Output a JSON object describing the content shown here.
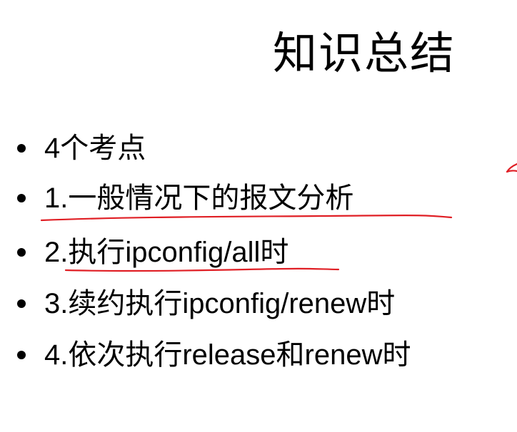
{
  "slide": {
    "title": "知识总结",
    "bullets": [
      {
        "label": "4个考点"
      },
      {
        "label": "1.一般情况下的报文分析"
      },
      {
        "label": "2.执行ipconfig/all时"
      },
      {
        "label": "3.续约执行ipconfig/renew时"
      },
      {
        "label": "4.依次执行release和renew时"
      }
    ],
    "annotation_color": "#e01f25"
  }
}
